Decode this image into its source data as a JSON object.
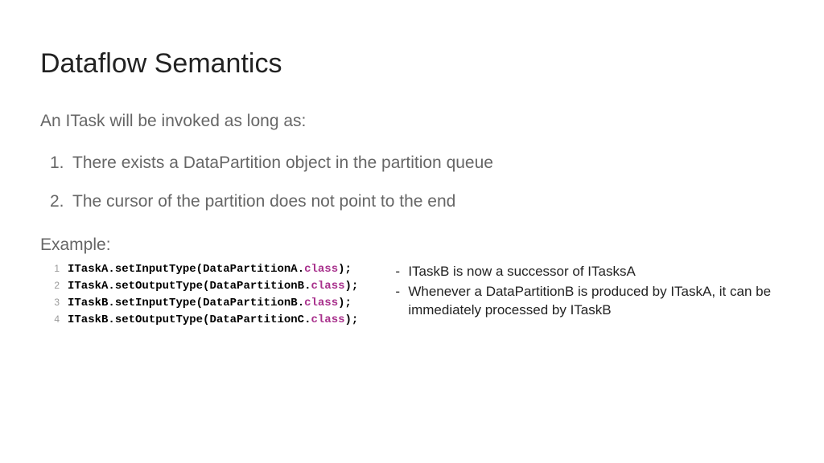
{
  "title": "Dataflow Semantics",
  "intro": "An ITask will be invoked as long as:",
  "conditions": [
    "There exists a DataPartition object in the partition queue",
    "The cursor of the partition does not point to the end"
  ],
  "example_label": "Example:",
  "code": [
    {
      "n": "1",
      "obj": "ITaskA",
      "call": "setInputType",
      "arg": "DataPartitionA"
    },
    {
      "n": "2",
      "obj": "ITaskA",
      "call": "setOutputType",
      "arg": "DataPartitionB"
    },
    {
      "n": "3",
      "obj": "ITaskB",
      "call": "setInputType",
      "arg": "DataPartitionB"
    },
    {
      "n": "4",
      "obj": "ITaskB",
      "call": "setOutputType",
      "arg": "DataPartitionC"
    }
  ],
  "keyword": "class",
  "notes": [
    "ITaskB is now a successor of ITasksA",
    "Whenever a DataPartitionB is produced by ITaskA, it can be immediately processed by ITaskB"
  ]
}
